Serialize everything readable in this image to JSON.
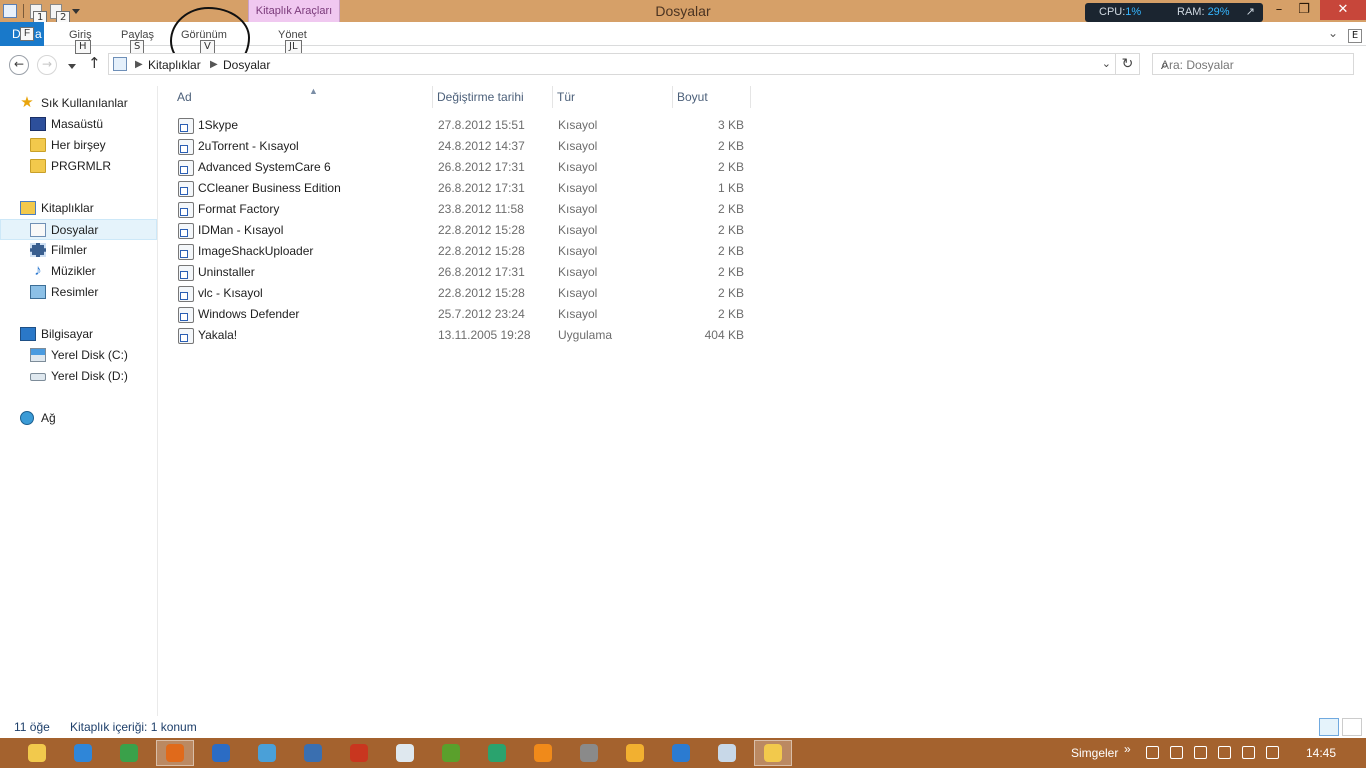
{
  "window": {
    "title": "Dosyalar",
    "context_tab": "Kitaplık Araçları"
  },
  "quick_access": {
    "keytip_1": "1",
    "keytip_2": "2"
  },
  "system_monitor": {
    "cpu_label": "CPU:",
    "cpu_value": "1%",
    "ram_label": "RAM:",
    "ram_value": "29%"
  },
  "ribbon": {
    "file_tab": "D",
    "file_keytip": "F",
    "file_tail": "a",
    "tabs": [
      {
        "label": "Giriş",
        "keytip": "H"
      },
      {
        "label": "Paylaş",
        "keytip": "S"
      },
      {
        "label": "Görünüm",
        "keytip": "V"
      },
      {
        "label": "Yönet",
        "keytip": "JL"
      }
    ],
    "help_keytip": "E"
  },
  "address": {
    "crumbs": [
      "Kitaplıklar",
      "Dosyalar"
    ],
    "search_placeholder": "Ara: Dosyalar"
  },
  "nav": {
    "favorites": "Sık Kullanılanlar",
    "favorite_items": [
      "Masaüstü",
      "Her birşey",
      "PRGRMLR"
    ],
    "libraries": "Kitaplıklar",
    "library_items": [
      "Dosyalar",
      "Filmler",
      "Müzikler",
      "Resimler"
    ],
    "computer": "Bilgisayar",
    "computer_items": [
      "Yerel Disk (C:)",
      "Yerel Disk (D:)"
    ],
    "network": "Ağ"
  },
  "columns": {
    "name": "Ad",
    "date": "Değiştirme tarihi",
    "type": "Tür",
    "size": "Boyut"
  },
  "files": [
    {
      "name": "1Skype",
      "date": "27.8.2012 15:51",
      "type": "Kısayol",
      "size": "3 KB"
    },
    {
      "name": "2uTorrent - Kısayol",
      "date": "24.8.2012 14:37",
      "type": "Kısayol",
      "size": "2 KB"
    },
    {
      "name": "Advanced SystemCare 6",
      "date": "26.8.2012 17:31",
      "type": "Kısayol",
      "size": "2 KB"
    },
    {
      "name": "CCleaner Business Edition",
      "date": "26.8.2012 17:31",
      "type": "Kısayol",
      "size": "1 KB"
    },
    {
      "name": "Format Factory",
      "date": "23.8.2012 11:58",
      "type": "Kısayol",
      "size": "2 KB"
    },
    {
      "name": "IDMan - Kısayol",
      "date": "22.8.2012 15:28",
      "type": "Kısayol",
      "size": "2 KB"
    },
    {
      "name": "ImageShackUploader",
      "date": "22.8.2012 15:28",
      "type": "Kısayol",
      "size": "2 KB"
    },
    {
      "name": "Uninstaller",
      "date": "26.8.2012 17:31",
      "type": "Kısayol",
      "size": "2 KB"
    },
    {
      "name": "vlc - Kısayol",
      "date": "22.8.2012 15:28",
      "type": "Kısayol",
      "size": "2 KB"
    },
    {
      "name": "Windows Defender",
      "date": "25.7.2012 23:24",
      "type": "Kısayol",
      "size": "2 KB"
    },
    {
      "name": "Yakala!",
      "date": "13.11.2005 19:28",
      "type": "Uygulama",
      "size": "404 KB"
    }
  ],
  "status": {
    "count": "11 öğe",
    "library_info": "Kitaplık içeriği: 1 konum"
  },
  "taskbar": {
    "apps": [
      {
        "name": "file-explorer",
        "color": "#f2c94c"
      },
      {
        "name": "internet-explorer",
        "color": "#2f86d8"
      },
      {
        "name": "chrome",
        "color": "#3aa14a"
      },
      {
        "name": "firefox",
        "color": "#e06a1b"
      },
      {
        "name": "ccleaner",
        "color": "#2b6cc4"
      },
      {
        "name": "iobit",
        "color": "#4aa0d8"
      },
      {
        "name": "advanced-systemcare",
        "color": "#3a6fb0"
      },
      {
        "name": "media-player",
        "color": "#c9361f"
      },
      {
        "name": "skype-like",
        "color": "#dfe8ef"
      },
      {
        "name": "utorrent",
        "color": "#5aa02c"
      },
      {
        "name": "chat-app",
        "color": "#2aa36e"
      },
      {
        "name": "vlc",
        "color": "#f08a1a"
      },
      {
        "name": "calculator",
        "color": "#8a8a8a"
      },
      {
        "name": "format-factory",
        "color": "#f2b030"
      },
      {
        "name": "yakala",
        "color": "#2b7bd1"
      },
      {
        "name": "remote-app",
        "color": "#c8d8e8"
      },
      {
        "name": "explorer-active",
        "color": "#f2c94c"
      }
    ],
    "tray_label": "Simgeler",
    "clock": "14:45"
  }
}
